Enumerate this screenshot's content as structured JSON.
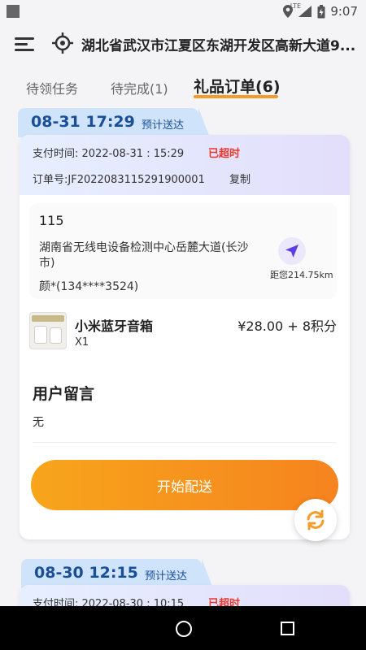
{
  "status_bar": {
    "network": "LTE",
    "time": "9:07"
  },
  "header": {
    "address": "湖北省武汉市江夏区东湖开发区高新大道9..."
  },
  "tabs": [
    {
      "label": "待领任务",
      "active": false
    },
    {
      "label": "待完成(1)",
      "active": false
    },
    {
      "label": "礼品订单(6)",
      "active": true
    }
  ],
  "orders": [
    {
      "date": "08-31 17:29",
      "date_label": "预计送达",
      "pay_time": "支付时间: 2022-08-31 : 15:29",
      "status": "已超时",
      "order_no": "订单号:JF2022083115291900001",
      "copy_label": "复制",
      "recipient_name": "115",
      "recipient_address": "湖南省无线电设备检测中心岳麓大道(长沙市)",
      "recipient_phone": "颜*(134****3524)",
      "distance": "距您214.75km",
      "product_name": "小米蓝牙音箱",
      "product_qty": "X1",
      "product_price": "¥28.00 + 8积分",
      "message_title": "用户留言",
      "message": "无",
      "action_label": "开始配送"
    },
    {
      "date": "08-30 12:15",
      "date_label": "预计送达",
      "pay_time": "支付时间: 2022-08-30 : 10:15",
      "status": "已超时"
    }
  ],
  "colors": {
    "accent": "#f39b2b",
    "overdue": "#e8382f",
    "date_text": "#1a4f97",
    "date_tag_bg": "#cfe3fb"
  },
  "icons": [
    "menu-icon",
    "location-target-icon",
    "navigation-arrow-icon",
    "refresh-icon",
    "home-circle-icon",
    "recents-square-icon"
  ]
}
